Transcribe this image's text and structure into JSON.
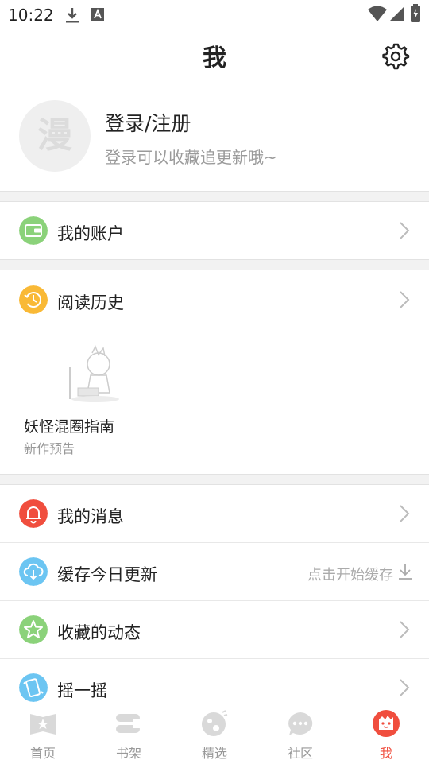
{
  "status_bar": {
    "time": "10:22",
    "icons": [
      "download-icon",
      "text-a-icon",
      "wifi-icon",
      "signal-icon",
      "battery-charging-icon"
    ]
  },
  "header": {
    "title": "我",
    "settings_icon": "gear-icon"
  },
  "profile": {
    "avatar_char": "漫",
    "title": "登录/注册",
    "subtitle": "登录可以收藏追更新哦~"
  },
  "account": {
    "label": "我的账户",
    "icon": "wallet-icon",
    "color": "#8bd27a"
  },
  "history": {
    "label": "阅读历史",
    "icon": "history-icon",
    "color": "#f9b936",
    "items": [
      {
        "title": "妖怪混圈指南",
        "subtitle": "新作预告"
      }
    ]
  },
  "menu": {
    "messages": {
      "label": "我的消息",
      "icon": "bell-icon",
      "color": "#f04e3e"
    },
    "cache": {
      "label": "缓存今日更新",
      "hint": "点击开始缓存",
      "icon": "cloud-download-icon",
      "color": "#6cc5f2"
    },
    "favorites": {
      "label": "收藏的动态",
      "icon": "star-icon",
      "color": "#8bd27a"
    },
    "shake": {
      "label": "摇一摇",
      "icon": "phone-shake-icon",
      "color": "#6cc5f2"
    }
  },
  "tabbar": {
    "active_color": "#f04e3e",
    "tabs": [
      {
        "label": "首页",
        "icon": "home-book-icon"
      },
      {
        "label": "书架",
        "icon": "bookshelf-icon"
      },
      {
        "label": "精选",
        "icon": "featured-icon"
      },
      {
        "label": "社区",
        "icon": "community-chat-icon"
      },
      {
        "label": "我",
        "icon": "me-avatar-icon",
        "active": true
      }
    ]
  }
}
